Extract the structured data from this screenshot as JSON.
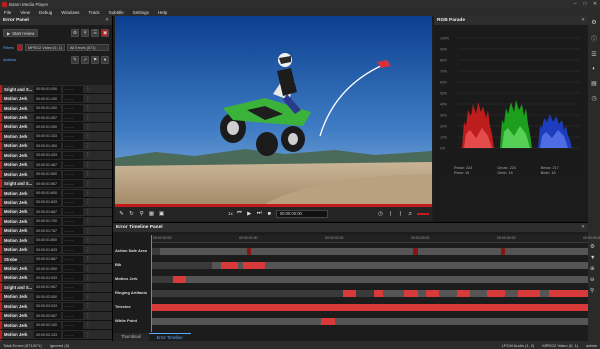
{
  "app": {
    "title": "Baton Media Player",
    "menu": [
      "File",
      "View",
      "Debug",
      "Windows",
      "Track",
      "Subtitle",
      "Settings",
      "Help"
    ]
  },
  "error_panel": {
    "title": "Error Panel",
    "start_review_label": "Start review",
    "filter_label": "Filters",
    "track_filter": "MPEG2 Video (0, 1)",
    "error_filter": "All Errors (571)",
    "actions_label": "Actions",
    "rows": [
      {
        "name": "Sright and S...",
        "tc": "00:00:01:000"
      },
      {
        "name": "Motion Jerk",
        "tc": "00:00:01:100"
      },
      {
        "name": "Motion Jerk",
        "tc": "00:00:01:200"
      },
      {
        "name": "Motion Jerk",
        "tc": "00:00:01:267"
      },
      {
        "name": "Motion Jerk",
        "tc": "00:00:01:300"
      },
      {
        "name": "Motion Jerk",
        "tc": "00:00:01:333"
      },
      {
        "name": "Motion Jerk",
        "tc": "00:00:01:400"
      },
      {
        "name": "Motion Jerk",
        "tc": "00:00:01:433"
      },
      {
        "name": "Motion Jerk",
        "tc": "00:00:01:467"
      },
      {
        "name": "Motion Jerk",
        "tc": "00:00:01:500"
      },
      {
        "name": "Sright and S...",
        "tc": "00:00:01:567"
      },
      {
        "name": "Motion Jerk",
        "tc": "00:00:01:600"
      },
      {
        "name": "Motion Jerk",
        "tc": "00:00:01:633"
      },
      {
        "name": "Motion Jerk",
        "tc": "00:00:01:667"
      },
      {
        "name": "Motion Jerk",
        "tc": "00:00:01:700"
      },
      {
        "name": "Motion Jerk",
        "tc": "00:00:01:767"
      },
      {
        "name": "Motion Jerk",
        "tc": "00:00:01:800"
      },
      {
        "name": "Motion Jerk",
        "tc": "00:00:01:833"
      },
      {
        "name": "Strobe",
        "tc": "00:00:01:867"
      },
      {
        "name": "Motion Jerk",
        "tc": "00:00:01:900"
      },
      {
        "name": "Motion Jerk",
        "tc": "00:00:01:933"
      },
      {
        "name": "Sright and S...",
        "tc": "00:00:01:967"
      },
      {
        "name": "Motion Jerk",
        "tc": "00:00:02:000"
      },
      {
        "name": "Motion Jerk",
        "tc": "00:00:02:033"
      },
      {
        "name": "Motion Jerk",
        "tc": "00:00:02:067"
      },
      {
        "name": "Motion Jerk",
        "tc": "00:00:02:100"
      },
      {
        "name": "Motion Jerk",
        "tc": "00:00:02:133"
      },
      {
        "name": "Motion Jerk",
        "tc": "00:00:02:167"
      }
    ]
  },
  "transport": {
    "speed": "1x",
    "timecode": "00:00:00:00"
  },
  "rgb_parade": {
    "title": "RGB Parade",
    "scale": [
      "100%",
      "90%",
      "80%",
      "70%",
      "60%",
      "50%",
      "40%",
      "30%",
      "20%",
      "10%",
      "0%"
    ],
    "stats": [
      {
        "label": "Rmax",
        "value": "224"
      },
      {
        "label": "Gmax",
        "value": "224"
      },
      {
        "label": "Bmax",
        "value": "217"
      },
      {
        "label": "Rmin",
        "value": "16"
      },
      {
        "label": "Gmin",
        "value": "16"
      },
      {
        "label": "Bmin",
        "value": "16"
      }
    ]
  },
  "timeline": {
    "title": "Error Timeline Panel",
    "ruler": [
      "00:00:00:00",
      "00:00:01:00",
      "00:00:02:00",
      "00:00:03:00",
      "00:00:04:00",
      "00:00:05:00"
    ],
    "rows": [
      {
        "label": "Action Safe Area"
      },
      {
        "label": "Blk"
      },
      {
        "label": "Motion Jerk"
      },
      {
        "label": "Ringing Artifacts"
      },
      {
        "label": "Telecine"
      },
      {
        "label": "White Point"
      }
    ],
    "tabs": [
      "Thumbnail",
      "Error Timeline"
    ]
  },
  "status": {
    "total_errors": "Total Errors (571/571)",
    "ignored": "Ignored (0)",
    "audio": "LPCM Audio (1, 2)",
    "video": "MPEG2 Video (0, 1)",
    "user": "admin"
  },
  "colors": {
    "accent": "#c21b1b",
    "link": "#5aa9ff",
    "playhead": "#2aa0e0"
  }
}
